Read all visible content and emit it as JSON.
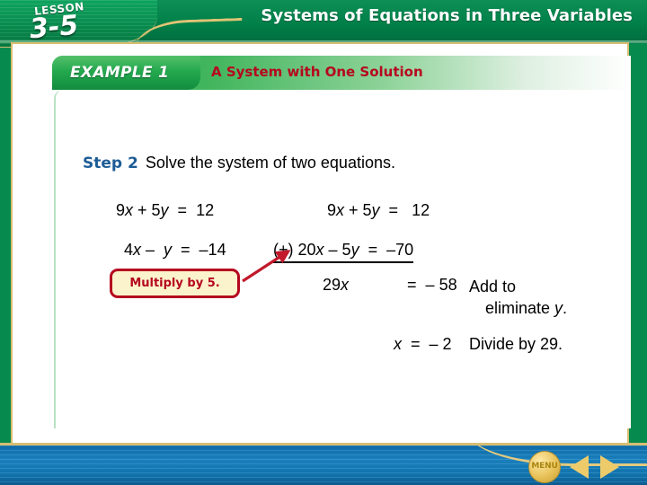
{
  "header": {
    "lesson_word": "LESSON",
    "lesson_number": "3-5",
    "chapter_title": "Systems of Equations in Three Variables"
  },
  "example": {
    "tab_label": "EXAMPLE 1",
    "heading": "A System with One Solution"
  },
  "body": {
    "step_label": "Step 2",
    "step_text": "Solve the system of two equations.",
    "equations": {
      "left_first": "9x + 5y  =  12",
      "left_second": "4x –  y  =  –14",
      "right_first": "9x + 5y  =   12",
      "right_second": "(+) 20x – 5y  =  –70",
      "sum": "29x             =  – 58",
      "final": "x  =  – 2"
    },
    "callout_label": "Multiply by 5.",
    "annotation_add_line1": "Add to",
    "annotation_add_line2": "eliminate y.",
    "annotation_divide": "Divide by 29."
  },
  "footer": {
    "menu_label": "MENU",
    "prev_icon": "triangle-left-icon",
    "next_icon": "triangle-right-icon"
  },
  "colors": {
    "banner_green": "#018049",
    "accent_gold": "#d8bd72",
    "step_blue": "#1d5c96",
    "heading_red": "#b5061f",
    "callout_fill": "#fbf3cb",
    "footer_blue": "#1b86c6"
  }
}
